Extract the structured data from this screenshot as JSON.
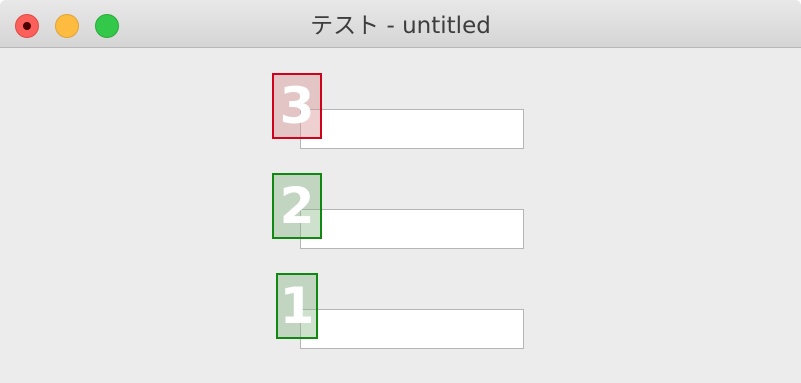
{
  "window": {
    "title": "テスト - untitled"
  },
  "controls": {
    "close_icon": "close-icon",
    "minimize_icon": "minimize-icon",
    "zoom_icon": "zoom-icon"
  },
  "fields": [
    {
      "value": "",
      "marker_label": "3",
      "marker_color": "#d0021b",
      "marker_fill": "#efcfcf"
    },
    {
      "value": "",
      "marker_label": "2",
      "marker_color": "#118811",
      "marker_fill": "#cddfcd"
    },
    {
      "value": "",
      "marker_label": "1",
      "marker_color": "#118811",
      "marker_fill": "#cddfcd"
    }
  ],
  "colors": {
    "window_bg": "#ececec",
    "close": "#fc605b",
    "minimize": "#fdbc40",
    "zoom": "#34c84a"
  }
}
